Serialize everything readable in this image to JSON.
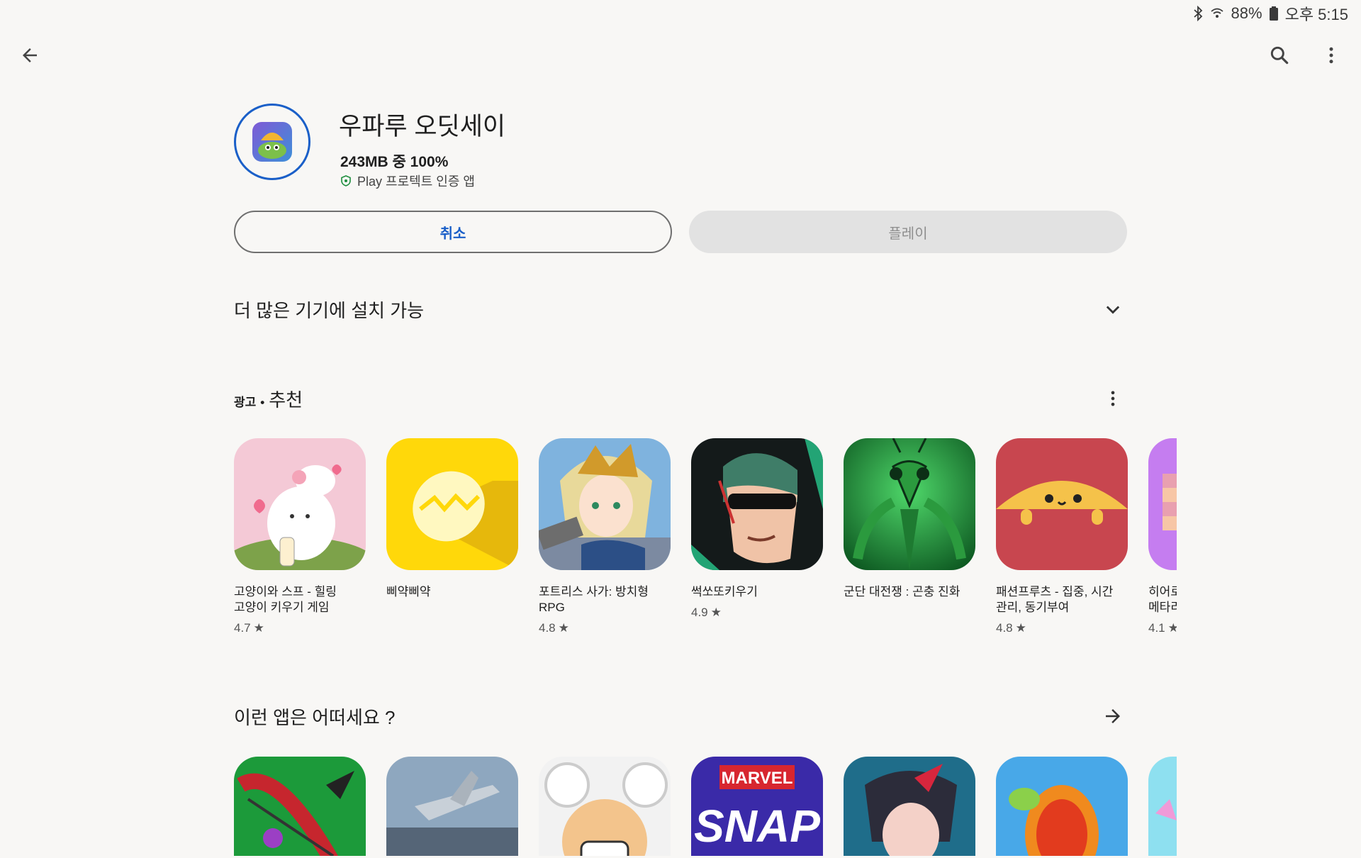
{
  "status_bar": {
    "battery": "88%",
    "time": "오후 5:15"
  },
  "toolbar": {
    "back_icon": "arrow-back-icon",
    "search_icon": "search-icon",
    "more_icon": "more-vert-icon"
  },
  "app": {
    "title": "우파루 오딧세이",
    "progress": "243MB 중 100%",
    "verified": "Play 프로텍트 인증 앱"
  },
  "buttons": {
    "cancel": "취소",
    "play": "플레이"
  },
  "more_devices": {
    "title": "더 많은 기기에 설치 가능"
  },
  "recommended": {
    "ad_label": "광고",
    "dot": "•",
    "title": "추천",
    "items": [
      {
        "name": "고양이와 스프 - 힐링\n고양이 키우기 게임",
        "rating": "4.7"
      },
      {
        "name": "삐약삐약",
        "rating": ""
      },
      {
        "name": "포트리스 사가: 방치형\nRPG",
        "rating": "4.8"
      },
      {
        "name": "썩쏘또키우기",
        "rating": "4.9"
      },
      {
        "name": "군단 대전쟁 : 곤충 진화",
        "rating": ""
      },
      {
        "name": "패션프루츠 - 집중, 시간\n관리, 동기부여",
        "rating": "4.8"
      },
      {
        "name": "히어로\n메타리",
        "rating": "4.1"
      }
    ]
  },
  "suggest": {
    "title": "이런 앱은 어떠세요 ?"
  },
  "colors": {
    "accent": "#1a5fc8",
    "background": "#f8f7f5"
  }
}
